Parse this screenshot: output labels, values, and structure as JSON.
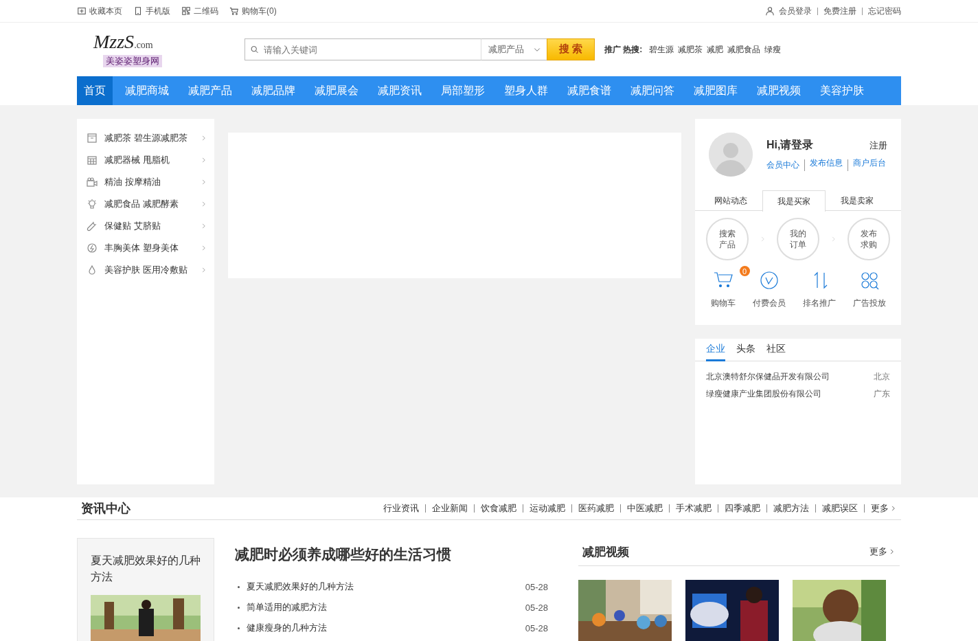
{
  "top_bar": {
    "left_links": [
      "收藏本页",
      "手机版",
      "二维码",
      "购物车(0)"
    ],
    "right_links": [
      "会员登录",
      "免费注册",
      "忘记密码"
    ]
  },
  "logo": {
    "mark": "MzzS",
    "domain": ".com",
    "tagline": "美姿姿塑身网"
  },
  "search": {
    "placeholder": "请输入关键词",
    "category": "减肥产品",
    "button": "搜 索",
    "hot_label": "推广 热搜:",
    "hot_terms": [
      "碧生源",
      "减肥茶",
      "减肥",
      "减肥食品",
      "绿瘦"
    ]
  },
  "nav": [
    {
      "label": "首页",
      "selected": true
    },
    {
      "label": "减肥商城",
      "selected": false
    },
    {
      "label": "减肥产品",
      "selected": false
    },
    {
      "label": "减肥品牌",
      "selected": false
    },
    {
      "label": "减肥展会",
      "selected": false
    },
    {
      "label": "减肥资讯",
      "selected": false
    },
    {
      "label": "局部塑形",
      "selected": false
    },
    {
      "label": "塑身人群",
      "selected": false
    },
    {
      "label": "减肥食谱",
      "selected": false
    },
    {
      "label": "减肥问答",
      "selected": false
    },
    {
      "label": "减肥图库",
      "selected": false
    },
    {
      "label": "减肥视频",
      "selected": false
    },
    {
      "label": "美容护肤",
      "selected": false
    }
  ],
  "sidebar": {
    "items": [
      "减肥茶 碧生源减肥茶",
      "减肥器械 甩脂机",
      "精油 按摩精油",
      "减肥食品 减肥酵素",
      "保健贴 艾脐贴",
      "丰胸美体 塑身美体",
      "美容护肤 医用冷敷贴"
    ]
  },
  "user_card": {
    "greeting": "Hi,请登录",
    "register": "注册",
    "links": [
      "会员中心",
      "发布信息",
      "商户后台"
    ],
    "tabs": [
      {
        "label": "网站动态",
        "selected": false
      },
      {
        "label": "我是买家",
        "selected": true
      },
      {
        "label": "我是卖家",
        "selected": false
      }
    ],
    "steps": [
      "搜索产品",
      "我的订单",
      "发布求购"
    ],
    "shortcuts": [
      {
        "label": "购物车",
        "badge": "0"
      },
      {
        "label": "付费会员"
      },
      {
        "label": "排名推广"
      },
      {
        "label": "广告投放"
      }
    ]
  },
  "news_card": {
    "tabs": [
      {
        "label": "企业",
        "selected": true
      },
      {
        "label": "头条",
        "selected": false
      },
      {
        "label": "社区",
        "selected": false
      }
    ],
    "rows": [
      {
        "company": "北京澳特舒尔保健品开发有限公司",
        "region": "北京"
      },
      {
        "company": "绿瘦健康产业集团股份有限公司",
        "region": "广东"
      }
    ]
  },
  "info_center": {
    "title": "资讯中心",
    "links": [
      "行业资讯",
      "企业新闻",
      "饮食减肥",
      "运动减肥",
      "医药减肥",
      "中医减肥",
      "手术减肥",
      "四季减肥",
      "减肥方法",
      "减肥误区"
    ],
    "more": "更多",
    "feature": {
      "title": "夏天减肥效果好的几种方法"
    },
    "headline": "减肥时必须养成哪些好的生活习惯",
    "articles": [
      {
        "title": "夏天减肥效果好的几种方法",
        "date": "05-28"
      },
      {
        "title": "简单适用的减肥方法",
        "date": "05-28"
      },
      {
        "title": "健康瘦身的几种方法",
        "date": "05-28"
      }
    ],
    "videos": {
      "title": "减肥视频",
      "more": "更多"
    }
  }
}
